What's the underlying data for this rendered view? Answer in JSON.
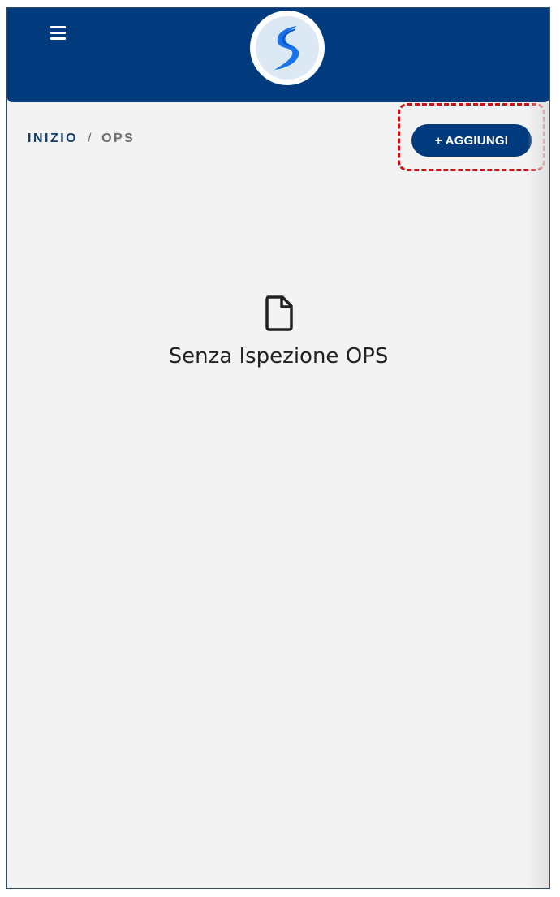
{
  "header": {
    "menu_icon": "hamburger-menu-icon",
    "logo_icon": "s-swirl-logo",
    "colors": {
      "header_bg": "#023a7e",
      "logo_blue": "#1a73e8"
    }
  },
  "breadcrumb": {
    "home": "INIZIO",
    "separator": "/",
    "current": "OPS"
  },
  "toolbar": {
    "add_label": "+ AGGIUNGI"
  },
  "empty_state": {
    "icon": "file-icon",
    "message": "Senza Ispezione OPS"
  },
  "annotation": {
    "color": "#cc0f14",
    "style": "dashed"
  }
}
